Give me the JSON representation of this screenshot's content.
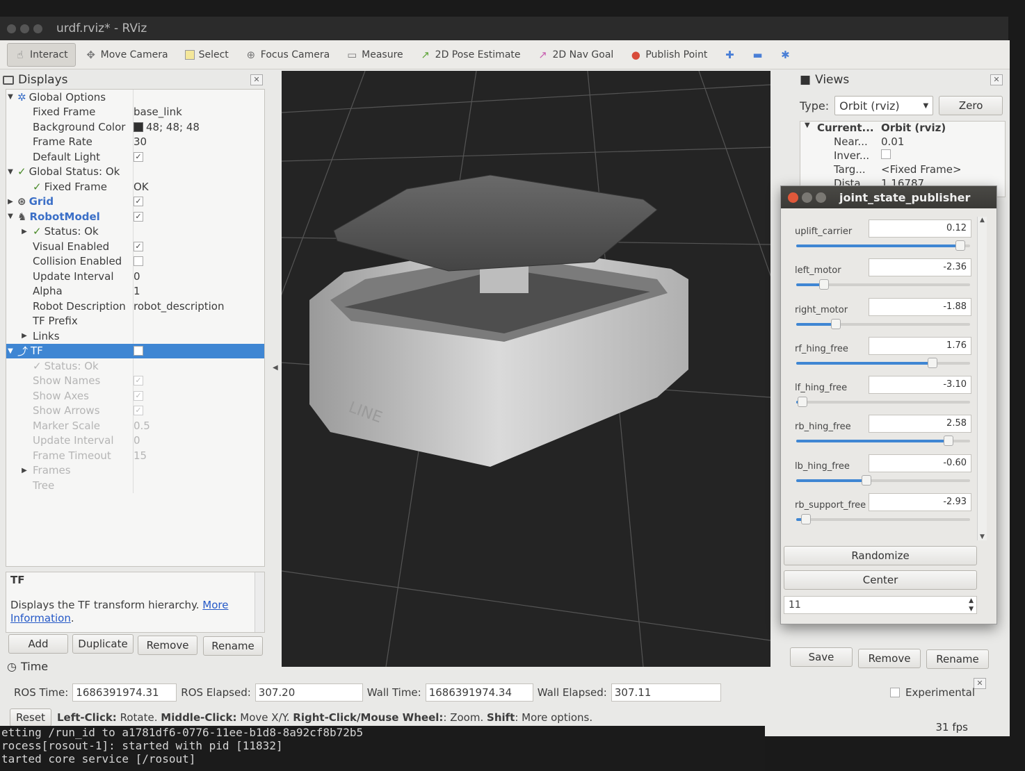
{
  "window": {
    "title": "urdf.rviz* - RViz"
  },
  "toolbar": {
    "tools": [
      {
        "label": "Interact",
        "icon": "hand-icon"
      },
      {
        "label": "Move Camera",
        "icon": "move-camera-icon"
      },
      {
        "label": "Select",
        "icon": "select-icon"
      },
      {
        "label": "Focus Camera",
        "icon": "focus-camera-icon"
      },
      {
        "label": "Measure",
        "icon": "measure-icon"
      },
      {
        "label": "2D Pose Estimate",
        "icon": "pose-estimate-icon"
      },
      {
        "label": "2D Nav Goal",
        "icon": "nav-goal-icon"
      },
      {
        "label": "Publish Point",
        "icon": "publish-point-icon"
      }
    ]
  },
  "displays": {
    "title": "Displays",
    "rows": [
      {
        "name": "Global Options",
        "value": ""
      },
      {
        "name": "Fixed Frame",
        "value": "base_link"
      },
      {
        "name": "Background Color",
        "value": "48; 48; 48"
      },
      {
        "name": "Frame Rate",
        "value": "30"
      },
      {
        "name": "Default Light",
        "value": "✓"
      },
      {
        "name": "Global Status: Ok",
        "value": ""
      },
      {
        "name": "Fixed Frame",
        "value": "OK"
      },
      {
        "name": "Grid",
        "value": "✓"
      },
      {
        "name": "RobotModel",
        "value": "✓"
      },
      {
        "name": "Status: Ok",
        "value": ""
      },
      {
        "name": "Visual Enabled",
        "value": "✓"
      },
      {
        "name": "Collision Enabled",
        "value": ""
      },
      {
        "name": "Update Interval",
        "value": "0"
      },
      {
        "name": "Alpha",
        "value": "1"
      },
      {
        "name": "Robot Description",
        "value": "robot_description"
      },
      {
        "name": "TF Prefix",
        "value": ""
      },
      {
        "name": "Links",
        "value": ""
      },
      {
        "name": "TF",
        "value": ""
      },
      {
        "name": "Status: Ok",
        "value": ""
      },
      {
        "name": "Show Names",
        "value": "✓"
      },
      {
        "name": "Show Axes",
        "value": "✓"
      },
      {
        "name": "Show Arrows",
        "value": "✓"
      },
      {
        "name": "Marker Scale",
        "value": "0.5"
      },
      {
        "name": "Update Interval",
        "value": "0"
      },
      {
        "name": "Frame Timeout",
        "value": "15"
      },
      {
        "name": "Frames",
        "value": ""
      },
      {
        "name": "Tree",
        "value": ""
      }
    ],
    "help_title": "TF",
    "help_text": "Displays the TF transform hierarchy.",
    "help_link": "More",
    "help_link2": "Information",
    "buttons": {
      "add": "Add",
      "duplicate": "Duplicate",
      "remove": "Remove",
      "rename": "Rename"
    }
  },
  "views": {
    "title": "Views",
    "type_label": "Type:",
    "type_value": "Orbit (rviz)",
    "zero": "Zero",
    "rows": [
      {
        "k": "Current...",
        "v": "Orbit (rviz)"
      },
      {
        "k": "Near...",
        "v": "0.01"
      },
      {
        "k": "Inver...",
        "v": ""
      },
      {
        "k": "Targ...",
        "v": "<Fixed Frame>"
      },
      {
        "k": "Dista...",
        "v": "1.16787"
      }
    ],
    "buttons": {
      "save": "Save",
      "remove": "Remove",
      "rename": "Rename"
    }
  },
  "joint_state_publisher": {
    "title": "joint_state_publisher",
    "joints": [
      {
        "name": "uplift_carrier",
        "value": "0.12",
        "fraction": 0.97
      },
      {
        "name": "left_motor",
        "value": "-2.36",
        "fraction": 0.14
      },
      {
        "name": "right_motor",
        "value": "-1.88",
        "fraction": 0.21
      },
      {
        "name": "rf_hing_free",
        "value": "1.76",
        "fraction": 0.8
      },
      {
        "name": "lf_hing_free",
        "value": "-3.10",
        "fraction": 0.01
      },
      {
        "name": "rb_hing_free",
        "value": "2.58",
        "fraction": 0.9
      },
      {
        "name": "lb_hing_free",
        "value": "-0.60",
        "fraction": 0.4
      },
      {
        "name": "rb_support_free",
        "value": "-2.93",
        "fraction": 0.03
      }
    ],
    "randomize": "Randomize",
    "center": "Center",
    "spin_value": "11"
  },
  "time": {
    "title": "Time",
    "ros_time_label": "ROS Time:",
    "ros_time": "1686391974.31",
    "ros_elapsed_label": "ROS Elapsed:",
    "ros_elapsed": "307.20",
    "wall_time_label": "Wall Time:",
    "wall_time": "1686391974.34",
    "wall_elapsed_label": "Wall Elapsed:",
    "wall_elapsed": "307.11",
    "experimental": "Experimental"
  },
  "status": {
    "reset": "Reset",
    "hint_lc": "Left-Click:",
    "hint_lc_t": "Rotate.",
    "hint_mc": "Middle-Click:",
    "hint_mc_t": "Move X/Y.",
    "hint_rc": "Right-Click/Mouse Wheel:",
    "hint_rc_t": ": Zoom.",
    "hint_sh": "Shift",
    "hint_sh_t": ": More options.",
    "fps": "31 fps"
  },
  "terminal": {
    "lines": [
      "etting /run_id to a1781df6-0776-11ee-b1d8-8a92cf8b72b5",
      "rocess[rosout-1]: started with pid [11832]",
      "tarted core service [/rosout]"
    ]
  },
  "colors": {
    "selection": "#3f86d3",
    "ok": "#4a8a2a",
    "viewport_bg": "#242424"
  }
}
